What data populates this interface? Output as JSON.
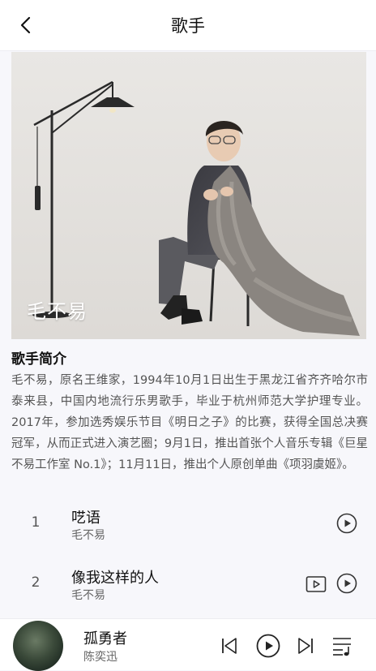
{
  "header": {
    "title": "歌手"
  },
  "hero": {
    "singer_name": "毛不易"
  },
  "intro": {
    "title": "歌手简介",
    "text": "毛不易，原名王维家，1994年10月1日出生于黑龙江省齐齐哈尔市泰来县，中国内地流行乐男歌手，毕业于杭州师范大学护理专业。2017年，参加选秀娱乐节目《明日之子》的比赛，获得全国总决赛冠军，从而正式进入演艺圈；9月1日，推出首张个人音乐专辑《巨星不易工作室 No.1》；11月11日，推出个人原创单曲《项羽虞姬》。"
  },
  "songs": [
    {
      "index": "1",
      "title": "呓语",
      "artist": "毛不易",
      "has_mv": false
    },
    {
      "index": "2",
      "title": "像我这样的人",
      "artist": "毛不易",
      "has_mv": true
    }
  ],
  "player": {
    "title": "孤勇者",
    "artist": "陈奕迅"
  },
  "icons": {
    "back": "chevron-left-icon",
    "play": "play-circle-icon",
    "mv": "video-icon",
    "prev": "skip-previous-icon",
    "next": "skip-next-icon",
    "playlist": "playlist-icon"
  },
  "colors": {
    "accent": "#111111",
    "muted": "#666666",
    "background": "#f7f7fb"
  }
}
